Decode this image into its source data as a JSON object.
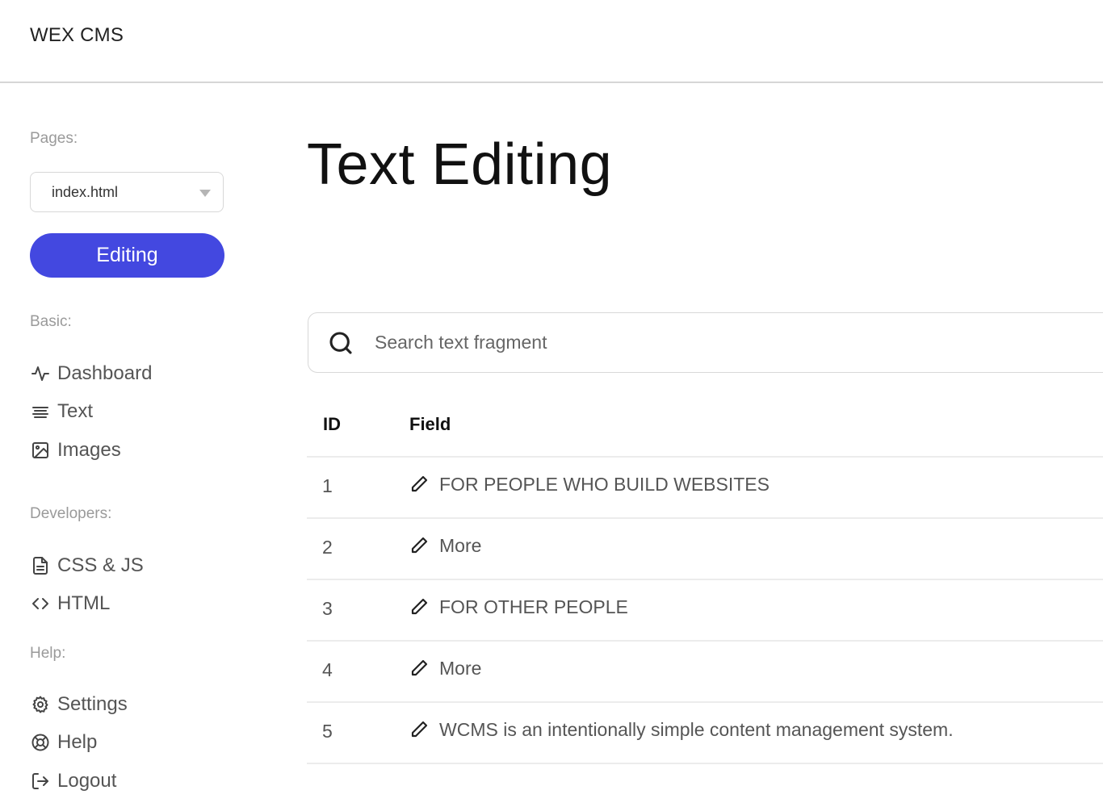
{
  "app": {
    "brand": "WEX CMS"
  },
  "sidebar": {
    "pages_label": "Pages:",
    "page_select": {
      "value": "index.html"
    },
    "editing_button": "Editing",
    "basic_label": "Basic:",
    "basic_items": [
      {
        "label": "Dashboard",
        "icon": "activity-icon"
      },
      {
        "label": "Text",
        "icon": "align-text-icon"
      },
      {
        "label": "Images",
        "icon": "image-icon"
      }
    ],
    "developers_label": "Developers:",
    "developer_items": [
      {
        "label": "CSS & JS",
        "icon": "file-text-icon"
      },
      {
        "label": "HTML",
        "icon": "code-icon"
      }
    ],
    "help_label": "Help:",
    "help_items": [
      {
        "label": "Settings",
        "icon": "gear-icon"
      },
      {
        "label": "Help",
        "icon": "life-buoy-icon"
      },
      {
        "label": "Logout",
        "icon": "logout-icon"
      }
    ]
  },
  "main": {
    "title": "Text Editing",
    "search": {
      "placeholder": "Search text fragment"
    },
    "table": {
      "headers": {
        "id": "ID",
        "field": "Field"
      },
      "rows": [
        {
          "id": "1",
          "field": "FOR PEOPLE WHO BUILD WEBSITES"
        },
        {
          "id": "2",
          "field": "More"
        },
        {
          "id": "3",
          "field": "FOR OTHER PEOPLE"
        },
        {
          "id": "4",
          "field": "More"
        },
        {
          "id": "5",
          "field": "WCMS is an intentionally simple content management system."
        }
      ]
    }
  },
  "colors": {
    "accent": "#4348e0",
    "border": "#d8d8d8",
    "muted": "#9a9a9a"
  }
}
